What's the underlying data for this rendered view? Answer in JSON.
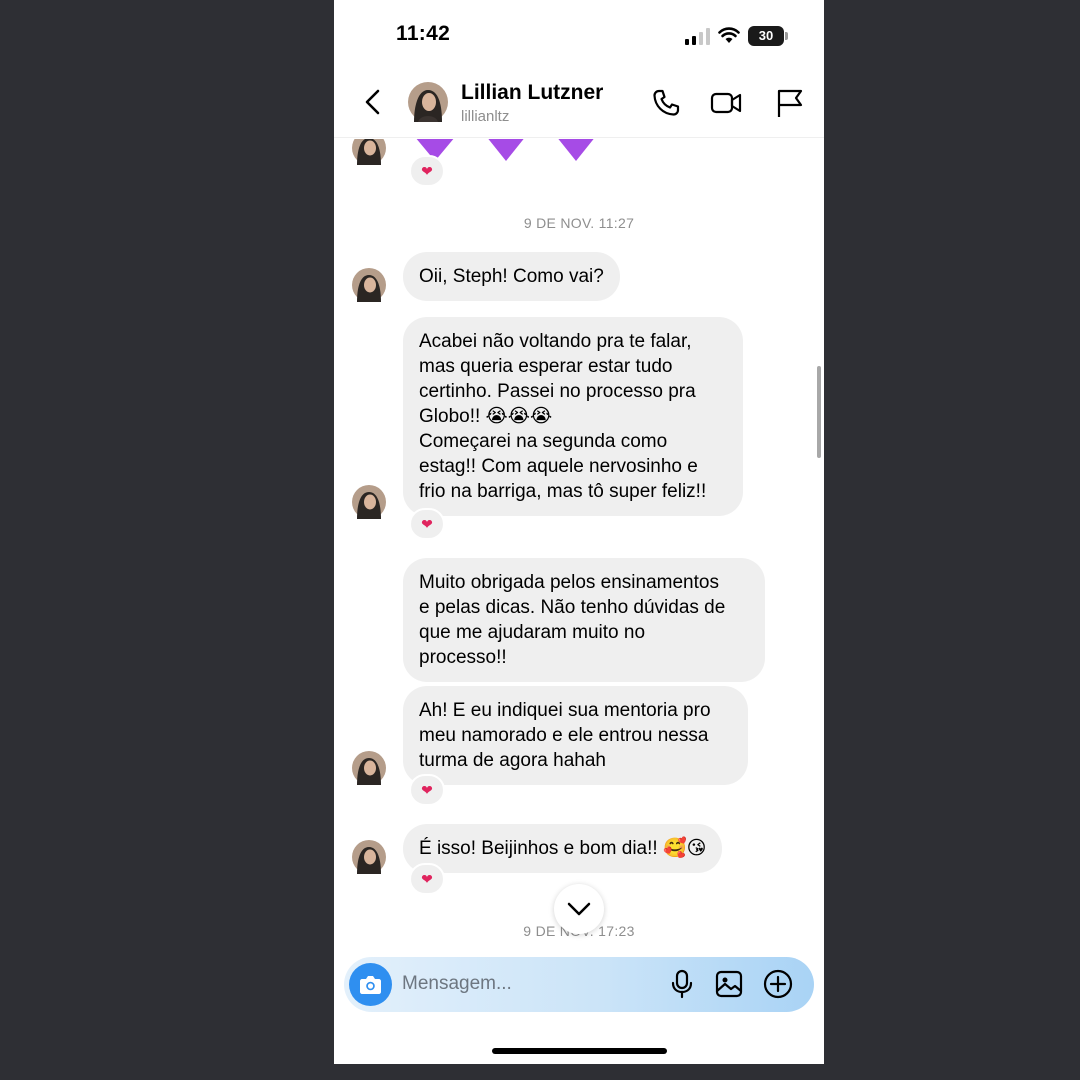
{
  "status_bar": {
    "time": "11:42",
    "battery": "30"
  },
  "header": {
    "name": "Lillian Lutzner",
    "handle": "lillianltz",
    "icons": [
      "back-icon",
      "phone-icon",
      "video-icon",
      "flag-icon"
    ]
  },
  "chat": {
    "timestamps": [
      "9 DE NOV. 11:27",
      "9 DE NOV. 17:23"
    ],
    "messages": [
      {
        "lines": [
          "Oii, Steph! Como vai?"
        ]
      },
      {
        "lines": [
          "Acabei não voltando pra te falar,",
          "mas queria esperar estar tudo",
          "certinho. Passei no processo pra",
          "Globo!! 😭😭😭",
          "Começarei na segunda como",
          "estag!! Com aquele nervosinho e",
          "frio na barriga, mas tô super feliz!!"
        ]
      },
      {
        "lines": [
          "Muito obrigada pelos ensinamentos",
          "e pelas dicas. Não tenho dúvidas de",
          "que me ajudaram muito no",
          "processo!!"
        ]
      },
      {
        "lines": [
          "Ah! E eu indiquei sua mentoria pro",
          "meu namorado e ele entrou nessa",
          "turma de agora hahah"
        ]
      },
      {
        "lines": [
          "É isso! Beijinhos e bom dia!! 🥰😘"
        ]
      }
    ],
    "reaction": "❤"
  },
  "composer": {
    "placeholder": "Mensagem..."
  },
  "colors": {
    "accent": "#2f8ff0",
    "bubble": "#efefef",
    "heart_purple": "#a64be6",
    "reaction_red": "#e0245e"
  }
}
